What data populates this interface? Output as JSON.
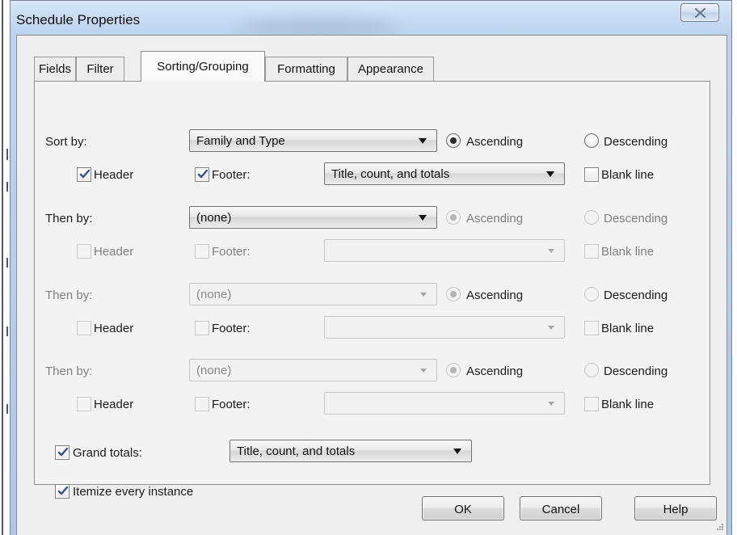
{
  "window": {
    "title": "Schedule Properties"
  },
  "tabs": [
    {
      "label": "Fields",
      "active": false
    },
    {
      "label": "Filter",
      "active": false
    },
    {
      "label": "Sorting/Grouping",
      "active": true
    },
    {
      "label": "Formatting",
      "active": false
    },
    {
      "label": "Appearance",
      "active": false
    }
  ],
  "sort_rows": [
    {
      "label": "Sort by:",
      "selected": "Family and Type",
      "order_options": [
        "Ascending",
        "Descending"
      ],
      "order_selected": "Ascending",
      "header": {
        "label": "Header",
        "checked": true
      },
      "footer": {
        "label": "Footer:",
        "checked": true
      },
      "footer_option": "Title, count, and totals",
      "blank_line": {
        "label": "Blank line",
        "checked": false
      }
    },
    {
      "label": "Then by:",
      "selected": "(none)",
      "order_options": [
        "Ascending",
        "Descending"
      ],
      "order_selected": "Ascending",
      "header": {
        "label": "Header",
        "checked": false
      },
      "footer": {
        "label": "Footer:",
        "checked": false
      },
      "footer_option": "",
      "blank_line": {
        "label": "Blank line",
        "checked": false
      }
    },
    {
      "label": "Then by:",
      "selected": "(none)",
      "order_options": [
        "Ascending",
        "Descending"
      ],
      "order_selected": "Ascending",
      "header": {
        "label": "Header",
        "checked": false
      },
      "footer": {
        "label": "Footer:",
        "checked": false
      },
      "footer_option": "",
      "blank_line": {
        "label": "Blank line",
        "checked": false
      }
    },
    {
      "label": "Then by:",
      "selected": "(none)",
      "order_options": [
        "Ascending",
        "Descending"
      ],
      "order_selected": "Ascending",
      "header": {
        "label": "Header",
        "checked": false
      },
      "footer": {
        "label": "Footer:",
        "checked": false
      },
      "footer_option": "",
      "blank_line": {
        "label": "Blank line",
        "checked": false
      }
    }
  ],
  "grand_totals": {
    "label": "Grand totals:",
    "checked": true,
    "selected": "Title, count, and totals"
  },
  "itemize": {
    "label": "Itemize every instance",
    "checked": true
  },
  "buttons": {
    "ok": "OK",
    "cancel": "Cancel",
    "help": "Help"
  },
  "icons": {
    "close": "close-icon",
    "check": "check-icon",
    "dropdown": "chevron-down-icon",
    "resize": "resize-grip-icon"
  }
}
